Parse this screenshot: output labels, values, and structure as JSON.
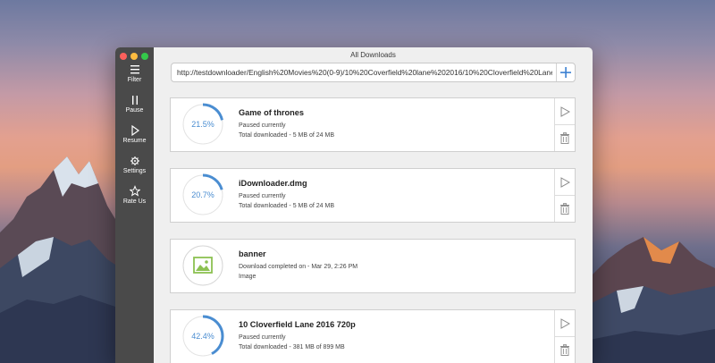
{
  "window": {
    "title": "All Downloads"
  },
  "sidebar": {
    "items": [
      {
        "label": "Filter",
        "icon": "hamburger-icon"
      },
      {
        "label": "Pause",
        "icon": "pause-icon"
      },
      {
        "label": "Resume",
        "icon": "play-icon"
      },
      {
        "label": "Settings",
        "icon": "gear-icon"
      },
      {
        "label": "Rate Us",
        "icon": "star-icon"
      }
    ]
  },
  "url_bar": {
    "value": "http://testdownloader/English%20Movies%20(0-9)/10%20Coverfield%20lane%202016/10%20Cloverfield%20Lane%20"
  },
  "downloads": [
    {
      "name": "Game of thrones",
      "status": "Paused currently",
      "detail": "Total downloaded - 5 MB of 24 MB",
      "progress": 0.215,
      "progress_text": "21.5%"
    },
    {
      "name": "iDownloader.dmg",
      "status": "Paused currently",
      "detail": "Total downloaded - 5 MB of 24 MB",
      "progress": 0.207,
      "progress_text": "20.7%"
    },
    {
      "name": "banner",
      "status": "Download completed on - Mar 29, 2:26 PM",
      "detail": "Image",
      "icon": "image-icon"
    },
    {
      "name": "10 Cloverfield Lane 2016 720p",
      "status": "Paused currently",
      "detail": "Total downloaded - 381 MB of 899 MB",
      "progress": 0.424,
      "progress_text": "42.4%"
    }
  ],
  "colors": {
    "accent": "#4a8dd1",
    "sidebar": "#4a4a4a",
    "image_icon": "#8cc152"
  }
}
